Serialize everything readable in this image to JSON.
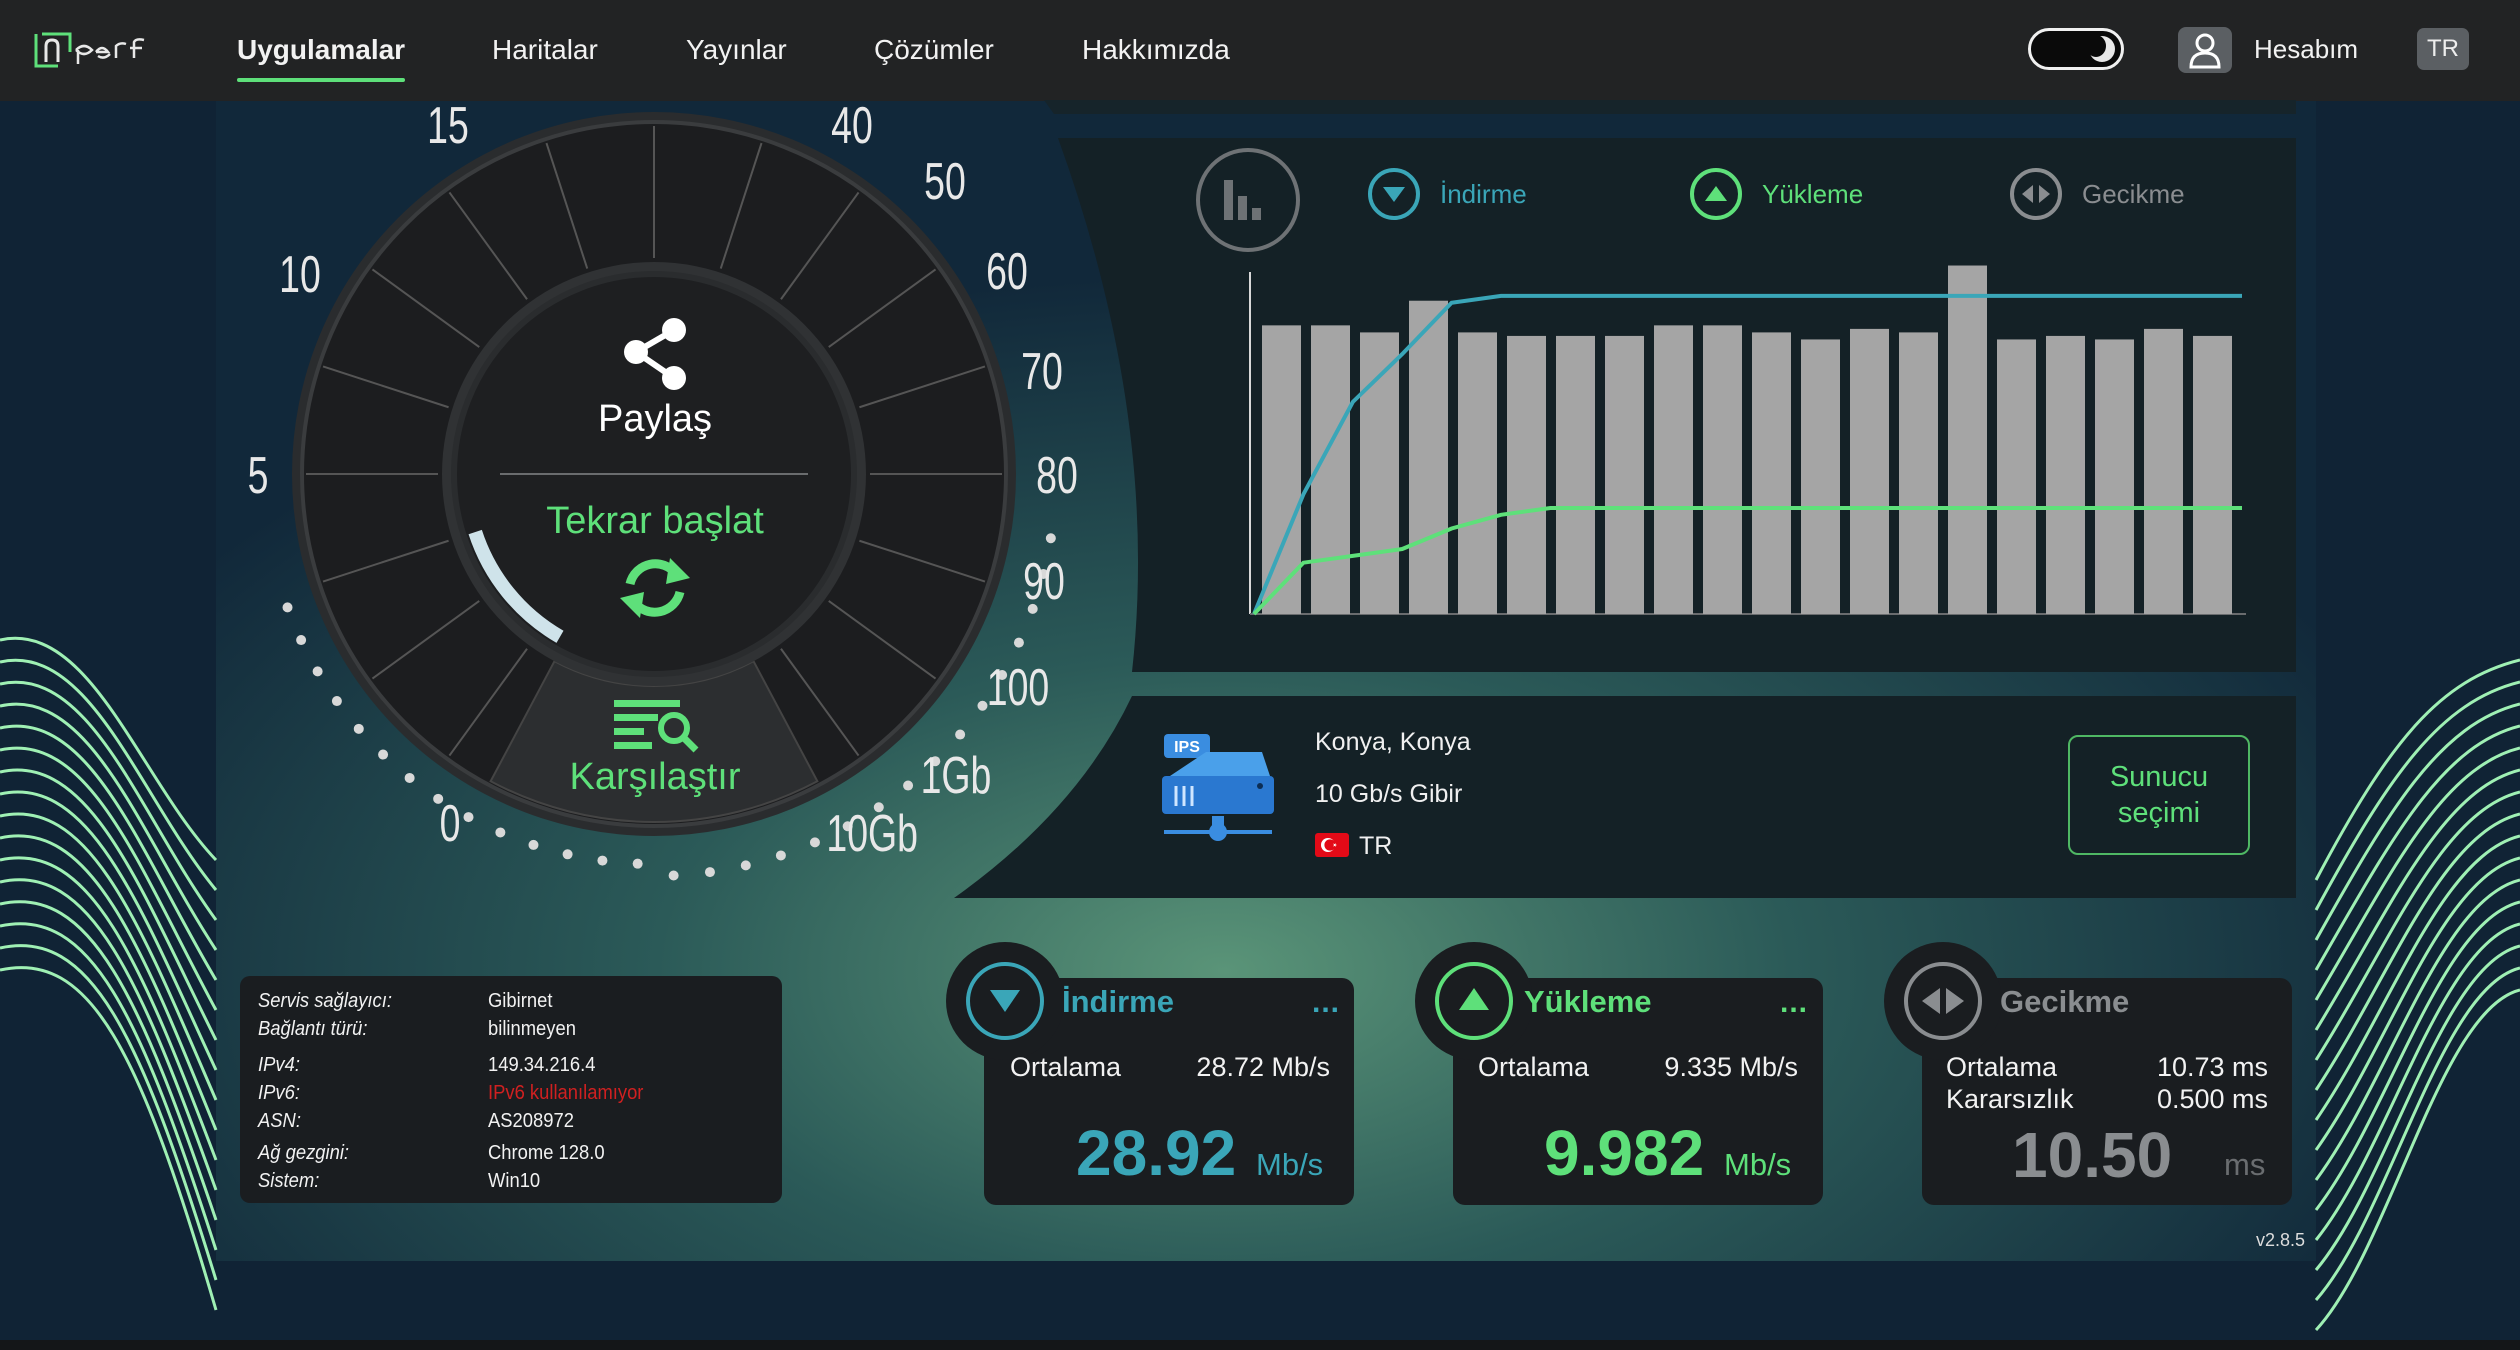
{
  "nav": {
    "items": [
      "Uygulamalar",
      "Haritalar",
      "Yayınlar",
      "Çözümler",
      "Hakkımızda"
    ],
    "active_index": 0,
    "account_label": "Hesabım",
    "language": "TR"
  },
  "dial": {
    "scale_labels": [
      "0",
      "5",
      "10",
      "15",
      "40",
      "50",
      "60",
      "70",
      "80",
      "90",
      "100",
      "1Gb",
      "10Gb"
    ],
    "share_label": "Paylaş",
    "restart_label": "Tekrar başlat",
    "compare_label": "Karşılaştır"
  },
  "chart_legend": {
    "download": "İndirme",
    "upload": "Yükleme",
    "latency": "Gecikme"
  },
  "chart_data": {
    "type": "bar",
    "bar_values": [
      0.82,
      0.82,
      0.8,
      0.89,
      0.8,
      0.79,
      0.79,
      0.79,
      0.82,
      0.82,
      0.8,
      0.78,
      0.81,
      0.8,
      0.99,
      0.78,
      0.79,
      0.78,
      0.81,
      0.79
    ],
    "download_line": [
      0.0,
      0.35,
      0.62,
      0.76,
      0.91,
      0.93,
      0.93,
      0.93,
      0.93,
      0.93,
      0.93,
      0.93,
      0.93,
      0.93,
      0.93,
      0.93,
      0.93,
      0.93,
      0.93,
      0.93,
      0.93
    ],
    "upload_line": [
      0.0,
      0.15,
      0.17,
      0.19,
      0.25,
      0.29,
      0.31,
      0.31,
      0.31,
      0.31,
      0.31,
      0.31,
      0.31,
      0.31,
      0.31,
      0.31,
      0.31,
      0.31,
      0.31,
      0.31,
      0.31
    ]
  },
  "server": {
    "location": "Konya, Konya",
    "provider": "10 Gb/s Gibir",
    "country": "TR",
    "badge": "IPS",
    "select_button": [
      "Sunucu",
      "seçimi"
    ]
  },
  "info": {
    "rows": [
      {
        "key": "Servis sağlayıcı:",
        "value": "Gibirnet"
      },
      {
        "key": "Bağlantı türü:",
        "value": "bilinmeyen"
      },
      {
        "key": "IPv4:",
        "value": "149.34.216.4"
      },
      {
        "key": "IPv6:",
        "value": "IPv6 kullanılamıyor"
      },
      {
        "key": "ASN:",
        "value": "AS208972"
      },
      {
        "key": "Ağ gezgini:",
        "value": "Chrome 128.0"
      },
      {
        "key": "Sistem:",
        "value": "Win10"
      }
    ]
  },
  "results": {
    "download": {
      "title": "İndirme",
      "avg_label": "Ortalama",
      "avg_value": "28.72 Mb/s",
      "value": "28.92",
      "unit": "Mb/s",
      "more": "..."
    },
    "upload": {
      "title": "Yükleme",
      "avg_label": "Ortalama",
      "avg_value": "9.335 Mb/s",
      "value": "9.982",
      "unit": "Mb/s",
      "more": "..."
    },
    "latency": {
      "title": "Gecikme",
      "avg_label": "Ortalama",
      "avg_value": "10.73 ms",
      "jitter_label": "Kararsızlık",
      "jitter_value": "0.500 ms",
      "value": "10.50",
      "unit": "ms"
    }
  },
  "version": "v2.8.5",
  "colors": {
    "download": "#3aa6b8",
    "upload": "#5ee07a",
    "latency": "#8a8d90",
    "ipv6_unavailable": "#d02020"
  }
}
